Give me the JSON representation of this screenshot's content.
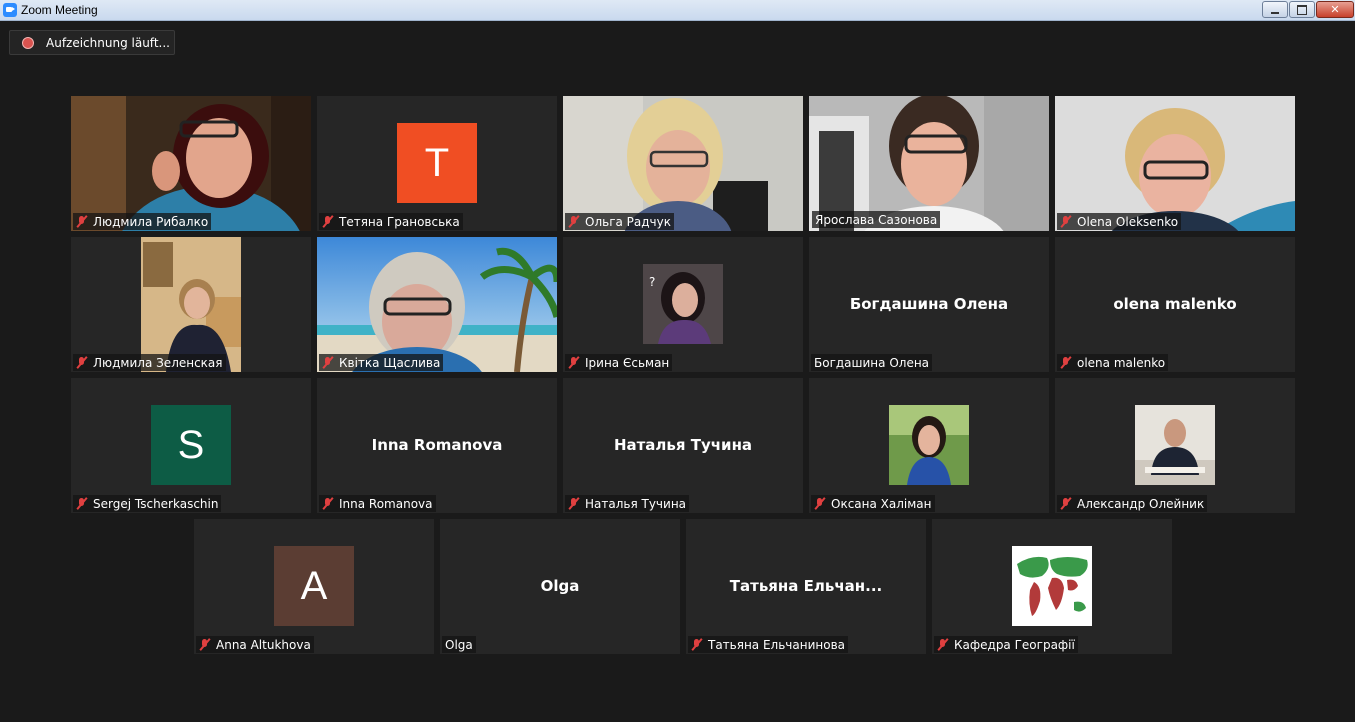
{
  "window": {
    "title": "Zoom Meeting",
    "close_glyph": "✕"
  },
  "recording": {
    "label": "Aufzeichnung läuft..."
  },
  "colors": {
    "speaking_border": "#c6e36b",
    "muted_icon": "#e04040",
    "avatar_t": "#f04e23",
    "avatar_s": "#0d5c45",
    "avatar_a": "#5b3d33"
  },
  "participants": [
    {
      "name": "Людмила Рибалко",
      "muted": true,
      "view": "video"
    },
    {
      "name": "Тетяна Грановська",
      "muted": true,
      "view": "avatar",
      "initial": "T"
    },
    {
      "name": "Ольга Радчук",
      "muted": true,
      "view": "video"
    },
    {
      "name": "Ярослава Сазонова",
      "muted": false,
      "view": "video",
      "speaking": true
    },
    {
      "name": "Olena Oleksenko",
      "muted": true,
      "view": "video"
    },
    {
      "name": "Людмила Зеленская",
      "muted": true,
      "view": "video"
    },
    {
      "name": "Квітка Щаслива",
      "muted": true,
      "view": "video"
    },
    {
      "name": "Ірина Єсьман",
      "muted": true,
      "view": "photo"
    },
    {
      "name": "Богдашина Олена",
      "muted": false,
      "view": "name",
      "display_name": "Богдашина Олена"
    },
    {
      "name": "olena malenko",
      "muted": true,
      "view": "name",
      "display_name": "olena malenko"
    },
    {
      "name": "Sergej Tscherkaschin",
      "muted": true,
      "view": "avatar",
      "initial": "S"
    },
    {
      "name": "Inna Romanova",
      "muted": true,
      "view": "name",
      "display_name": "Inna Romanova"
    },
    {
      "name": "Наталья Тучина",
      "muted": true,
      "view": "name",
      "display_name": "Наталья Тучина"
    },
    {
      "name": "Оксана Халіман",
      "muted": true,
      "view": "photo"
    },
    {
      "name": "Александр Олейник",
      "muted": true,
      "view": "photo"
    },
    {
      "name": "Anna Altukhova",
      "muted": true,
      "view": "avatar",
      "initial": "A"
    },
    {
      "name": "Olga",
      "muted": false,
      "view": "name",
      "display_name": "Olga"
    },
    {
      "name": "Татьяна Ельчанинова",
      "muted": true,
      "view": "name",
      "display_name": "Татьяна  Ельчан..."
    },
    {
      "name": "Кафедра Географії",
      "muted": true,
      "view": "photo"
    }
  ]
}
